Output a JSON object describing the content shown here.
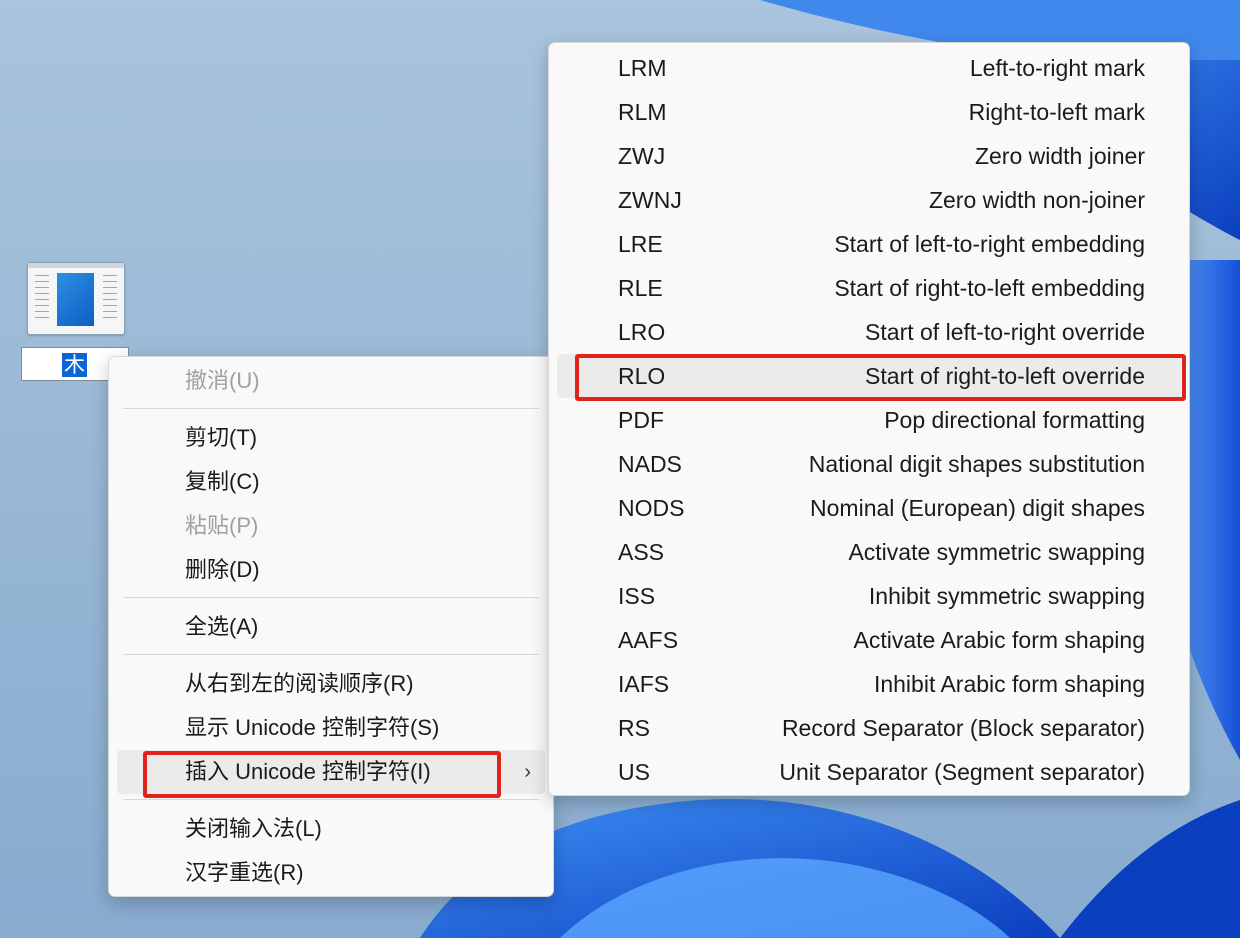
{
  "desktop": {
    "icon_name": "document-icon",
    "rename_value": "木"
  },
  "context_menu": {
    "items": [
      {
        "label": "撤消(U)",
        "disabled": true
      },
      {
        "label": "剪切(T)",
        "disabled": false
      },
      {
        "label": "复制(C)",
        "disabled": false
      },
      {
        "label": "粘贴(P)",
        "disabled": true
      },
      {
        "label": "删除(D)",
        "disabled": false
      },
      {
        "label": "全选(A)",
        "disabled": false
      },
      {
        "label": "从右到左的阅读顺序(R)",
        "disabled": false
      },
      {
        "label": "显示 Unicode 控制字符(S)",
        "disabled": false
      },
      {
        "label": "插入 Unicode 控制字符(I)",
        "disabled": false,
        "has_submenu": true,
        "highlighted": true
      },
      {
        "label": "关闭输入法(L)",
        "disabled": false
      },
      {
        "label": "汉字重选(R)",
        "disabled": false
      }
    ],
    "submenu_arrow": "›"
  },
  "submenu": {
    "items": [
      {
        "code": "LRM",
        "desc": "Left-to-right mark"
      },
      {
        "code": "RLM",
        "desc": "Right-to-left mark"
      },
      {
        "code": "ZWJ",
        "desc": "Zero width joiner"
      },
      {
        "code": "ZWNJ",
        "desc": "Zero width non-joiner"
      },
      {
        "code": "LRE",
        "desc": "Start of left-to-right embedding"
      },
      {
        "code": "RLE",
        "desc": "Start of right-to-left embedding"
      },
      {
        "code": "LRO",
        "desc": "Start of left-to-right override"
      },
      {
        "code": "RLO",
        "desc": "Start of right-to-left override",
        "highlighted": true
      },
      {
        "code": "PDF",
        "desc": "Pop directional formatting"
      },
      {
        "code": "NADS",
        "desc": "National digit shapes substitution"
      },
      {
        "code": "NODS",
        "desc": "Nominal (European) digit shapes"
      },
      {
        "code": "ASS",
        "desc": "Activate symmetric swapping"
      },
      {
        "code": "ISS",
        "desc": "Inhibit symmetric swapping"
      },
      {
        "code": "AAFS",
        "desc": "Activate Arabic form shaping"
      },
      {
        "code": "IAFS",
        "desc": "Inhibit Arabic form shaping"
      },
      {
        "code": "RS",
        "desc": "Record Separator (Block separator)"
      },
      {
        "code": "US",
        "desc": "Unit Separator (Segment separator)"
      }
    ]
  },
  "colors": {
    "highlight_box": "#e0231c",
    "menu_bg": "#f9f9f9",
    "wallpaper_accent": "#1a6cf0"
  }
}
